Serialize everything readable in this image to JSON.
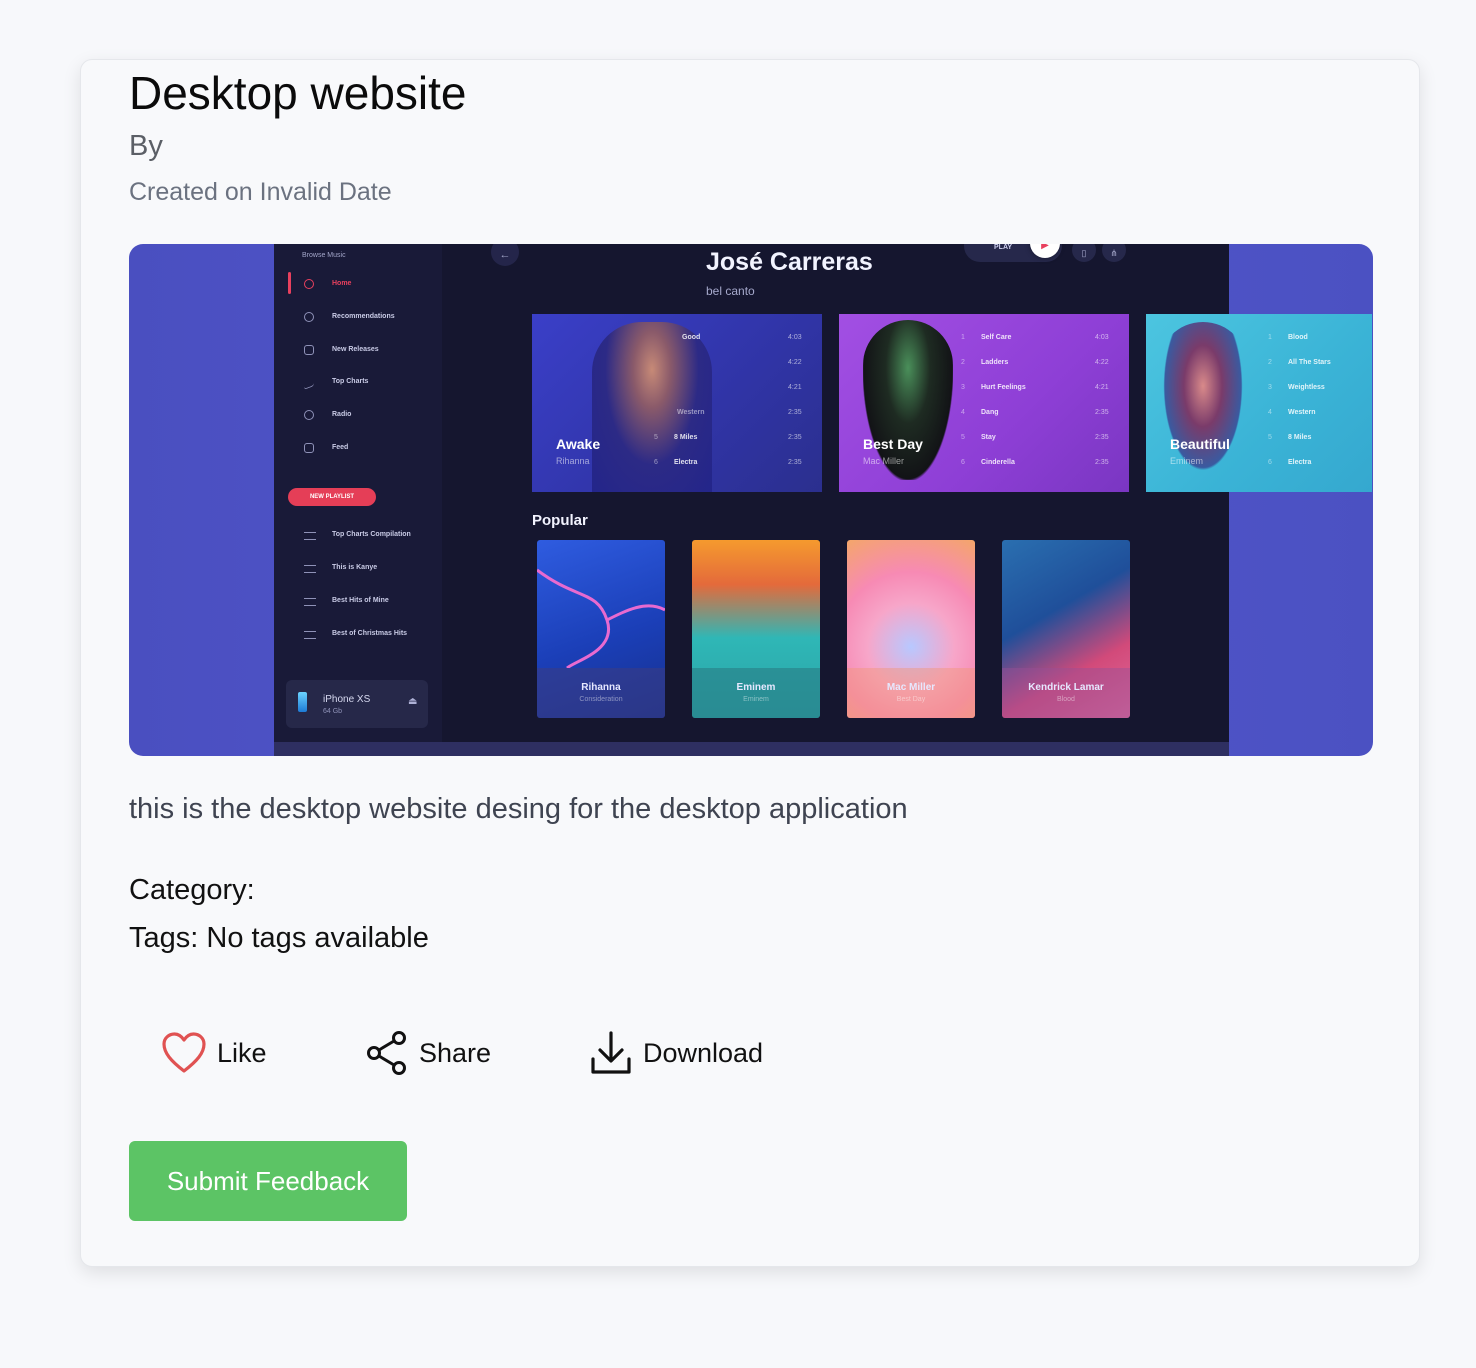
{
  "post": {
    "title": "Desktop website",
    "by": "By",
    "created": "Created on Invalid Date",
    "description": "this is the desktop website desing for the desktop application",
    "category": "Category:",
    "tags": "Tags: No tags available"
  },
  "actions": {
    "like": "Like",
    "share": "Share",
    "download": "Download",
    "submit": "Submit Feedback"
  },
  "screenshot": {
    "sidebar_heading": "Browse Music",
    "nav": [
      "Home",
      "Recommendations",
      "New Releases",
      "Top Charts",
      "Radio",
      "Feed"
    ],
    "new_playlist": "NEW PLAYLIST",
    "playlists": [
      "Top Charts Compilation",
      "This is Kanye",
      "Best Hits of Mine",
      "Best of Christmas Hits"
    ],
    "device_name": "iPhone XS",
    "device_storage": "64 Gb",
    "artist": "José Carreras",
    "genre": "bel canto",
    "play_label": "PLAY",
    "popular_heading": "Popular",
    "albums": [
      {
        "name": "Awake",
        "artist": "Rihanna",
        "tracks": [
          "Good",
          "",
          "",
          "Western",
          "8 Miles",
          "Electra"
        ],
        "times": [
          "4:03",
          "4:22",
          "4:21",
          "2:35",
          "2:35",
          "2:35"
        ]
      },
      {
        "name": "Best Day",
        "artist": "Mac Miller",
        "tracks": [
          "Self Care",
          "Ladders",
          "Hurt Feelings",
          "Dang",
          "Stay",
          "Cinderella"
        ],
        "times": [
          "4:03",
          "4:22",
          "4:21",
          "2:35",
          "2:35",
          "2:35"
        ]
      },
      {
        "name": "Beautiful",
        "artist": "Eminem",
        "tracks": [
          "Blood",
          "All The Stars",
          "Weightless",
          "Western",
          "8 Miles",
          "Electra"
        ],
        "times": []
      }
    ],
    "popular": [
      {
        "name": "Rihanna",
        "sub": "Consideration"
      },
      {
        "name": "Eminem",
        "sub": "Eminem"
      },
      {
        "name": "Mac Miller",
        "sub": "Best Day"
      },
      {
        "name": "Kendrick Lamar",
        "sub": "Blood"
      }
    ]
  },
  "colors": {
    "like_heart": "#e05252",
    "submit_bg": "#5cc465",
    "accent": "#e8405e"
  },
  "icons": {
    "like": "heart-outline-icon",
    "share": "share-nodes-icon",
    "download": "download-tray-icon"
  }
}
